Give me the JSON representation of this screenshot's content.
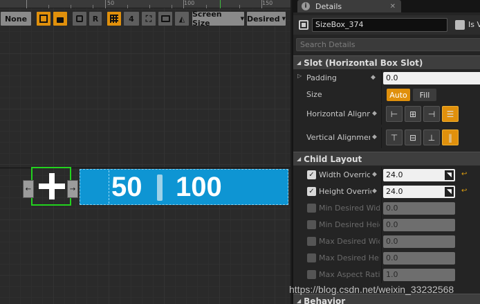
{
  "ruler": {
    "labels": [
      "50",
      "100",
      "150"
    ]
  },
  "toolbar": {
    "anchor_label": "None",
    "r_label": "R",
    "grid_value": "4",
    "screen_size_label": "Screen Size",
    "desired_label": "Desired"
  },
  "canvas": {
    "left_handle": "←",
    "right_handle": "→",
    "value_left": "50",
    "value_right": "100"
  },
  "details": {
    "tab_label": "Details",
    "widget_name": "SizeBox_374",
    "is_variable_label": "Is Va",
    "search_placeholder": "Search Details",
    "slot": {
      "title": "Slot (Horizontal Box Slot)",
      "padding_label": "Padding",
      "padding_value": "0.0",
      "size_label": "Size",
      "size_auto": "Auto",
      "size_fill": "Fill",
      "halign_label": "Horizontal Alignm",
      "valign_label": "Vertical Alignmen"
    },
    "child_layout": {
      "title": "Child Layout",
      "rows": [
        {
          "label": "Width Override",
          "value": "24.0",
          "enabled": true
        },
        {
          "label": "Height Override",
          "value": "24.0",
          "enabled": true
        },
        {
          "label": "Min Desired Width",
          "value": "0.0",
          "enabled": false
        },
        {
          "label": "Min Desired Height",
          "value": "0.0",
          "enabled": false
        },
        {
          "label": "Max Desired Width",
          "value": "0.0",
          "enabled": false
        },
        {
          "label": "Max Desired Height",
          "value": "0.0",
          "enabled": false
        },
        {
          "label": "Max Aspect Ratio",
          "value": "1.0",
          "enabled": false
        }
      ]
    },
    "behavior_title": "Behavior"
  },
  "watermark": "https://blog.csdn.net/weixin_33232568",
  "colors": {
    "accent": "#e0900c",
    "selection": "#22d31e",
    "bar": "#0e95d3"
  }
}
